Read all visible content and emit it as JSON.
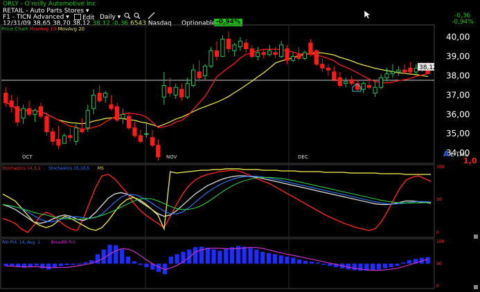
{
  "header": {
    "ticker_line": "ORLY - O'reilly Automotive Inc",
    "sector": "RETAIL - Auto Parts Stores",
    "sector_arrow": "▾",
    "layout": "F1 - TICN Advanced",
    "layout_arrow": "▾",
    "edit": "Edit",
    "period": "Daily",
    "period_arrow": "▾",
    "quote": {
      "date": "12/31/09",
      "open": "38,65",
      "high": "38,70",
      "low": "38,12",
      "close": "38,12",
      "change": "-0,36",
      "volume": "6543",
      "exchange": "Nasdaq",
      "optionable": "Optionable",
      "pct_badge": "-0,94%"
    },
    "change_right": "-0,36",
    "pct_right": "-0,94%",
    "overlay_legend": {
      "price": "Price Chart",
      "ma1": "MovAvg 10",
      "ma2": "MovAvg 20"
    }
  },
  "price_axis": {
    "ticks": [
      "40,00",
      "39,00",
      "38,00",
      "37,00",
      "36,00",
      "35,00",
      "34,00"
    ],
    "last_price": "38,12"
  },
  "x_axis": {
    "labels": [
      "OCT",
      "NOV",
      "DEC"
    ]
  },
  "alert_box": {
    "letter": "A",
    "text": "L TML",
    "value": "1,0"
  },
  "stoch_pane": {
    "legend": [
      "Stochastics 14,3,1",
      "Stochastics 35,10,5",
      "MS"
    ],
    "ticks": [
      "100",
      "50",
      "0"
    ]
  },
  "rsi_pane": {
    "legend": [
      "RSI Pct. 14, Avg. 1",
      "Breadth Pct."
    ],
    "ticks": [
      "100",
      "50",
      "0"
    ]
  },
  "colors": {
    "up": "#22c55e",
    "down": "#ff1a1a",
    "ma_red": "#ff1a1a",
    "ma_yellow": "#e6e34a",
    "badge": "#16c60c"
  },
  "chart_data": [
    {
      "type": "candlestick",
      "title": "ORLY - O'reilly Automotive Inc",
      "y_range": [
        33.5,
        40.6
      ],
      "ylim": [
        33.5,
        40.6
      ],
      "candles": [
        {
          "o": 37.1,
          "h": 37.4,
          "l": 36.4,
          "c": 36.6
        },
        {
          "o": 36.7,
          "h": 37.0,
          "l": 36.1,
          "c": 36.4
        },
        {
          "o": 36.4,
          "h": 36.9,
          "l": 35.4,
          "c": 35.6
        },
        {
          "o": 35.8,
          "h": 36.5,
          "l": 35.5,
          "c": 36.3
        },
        {
          "o": 36.3,
          "h": 36.7,
          "l": 35.9,
          "c": 36.0
        },
        {
          "o": 36.0,
          "h": 36.3,
          "l": 35.6,
          "c": 36.2
        },
        {
          "o": 36.4,
          "h": 36.6,
          "l": 35.8,
          "c": 35.9
        },
        {
          "o": 35.9,
          "h": 36.1,
          "l": 34.9,
          "c": 35.1
        },
        {
          "o": 35.1,
          "h": 35.3,
          "l": 34.4,
          "c": 34.6
        },
        {
          "o": 34.7,
          "h": 35.4,
          "l": 34.2,
          "c": 34.4
        },
        {
          "o": 34.5,
          "h": 35.0,
          "l": 34.5,
          "c": 34.9
        },
        {
          "o": 34.9,
          "h": 35.3,
          "l": 34.6,
          "c": 34.8
        },
        {
          "o": 34.6,
          "h": 35.5,
          "l": 34.4,
          "c": 35.3
        },
        {
          "o": 35.2,
          "h": 35.8,
          "l": 35.0,
          "c": 35.1
        },
        {
          "o": 35.3,
          "h": 36.5,
          "l": 35.1,
          "c": 36.2
        },
        {
          "o": 36.3,
          "h": 37.3,
          "l": 36.0,
          "c": 37.0
        },
        {
          "o": 37.1,
          "h": 37.5,
          "l": 36.6,
          "c": 36.7
        },
        {
          "o": 36.9,
          "h": 37.2,
          "l": 36.6,
          "c": 37.1
        },
        {
          "o": 36.5,
          "h": 37.0,
          "l": 36.2,
          "c": 36.3
        },
        {
          "o": 36.4,
          "h": 36.6,
          "l": 35.6,
          "c": 35.7
        },
        {
          "o": 35.8,
          "h": 36.3,
          "l": 35.5,
          "c": 36.0
        },
        {
          "o": 35.9,
          "h": 36.1,
          "l": 35.2,
          "c": 35.3
        },
        {
          "o": 35.3,
          "h": 35.6,
          "l": 34.8,
          "c": 34.9
        },
        {
          "o": 34.9,
          "h": 35.2,
          "l": 34.5,
          "c": 34.6
        },
        {
          "o": 35.0,
          "h": 35.6,
          "l": 34.8,
          "c": 35.0
        },
        {
          "o": 34.8,
          "h": 35.2,
          "l": 34.3,
          "c": 34.4
        },
        {
          "o": 34.4,
          "h": 34.7,
          "l": 33.6,
          "c": 33.8
        },
        {
          "o": 36.9,
          "h": 38.2,
          "l": 36.5,
          "c": 37.5
        },
        {
          "o": 37.4,
          "h": 37.9,
          "l": 36.9,
          "c": 37.1
        },
        {
          "o": 37.0,
          "h": 37.6,
          "l": 36.8,
          "c": 37.4
        },
        {
          "o": 37.3,
          "h": 37.6,
          "l": 36.7,
          "c": 36.9
        },
        {
          "o": 36.9,
          "h": 37.9,
          "l": 36.8,
          "c": 37.6
        },
        {
          "o": 37.5,
          "h": 38.6,
          "l": 37.4,
          "c": 38.3
        },
        {
          "o": 38.2,
          "h": 38.8,
          "l": 37.7,
          "c": 37.9
        },
        {
          "o": 38.0,
          "h": 38.6,
          "l": 37.8,
          "c": 38.5
        },
        {
          "o": 38.5,
          "h": 39.5,
          "l": 38.4,
          "c": 39.3
        },
        {
          "o": 39.3,
          "h": 39.8,
          "l": 38.8,
          "c": 39.0
        },
        {
          "o": 39.0,
          "h": 40.1,
          "l": 39.0,
          "c": 39.9
        },
        {
          "o": 39.9,
          "h": 40.3,
          "l": 39.2,
          "c": 39.4
        },
        {
          "o": 39.3,
          "h": 39.7,
          "l": 39.0,
          "c": 39.6
        },
        {
          "o": 39.5,
          "h": 40.0,
          "l": 39.3,
          "c": 39.8
        },
        {
          "o": 39.7,
          "h": 39.9,
          "l": 39.2,
          "c": 39.4
        },
        {
          "o": 39.4,
          "h": 39.6,
          "l": 38.9,
          "c": 39.0
        },
        {
          "o": 39.0,
          "h": 39.5,
          "l": 38.8,
          "c": 39.2
        },
        {
          "o": 39.2,
          "h": 39.4,
          "l": 38.9,
          "c": 39.1
        },
        {
          "o": 39.1,
          "h": 39.6,
          "l": 39.0,
          "c": 39.3
        },
        {
          "o": 39.2,
          "h": 39.5,
          "l": 38.9,
          "c": 39.1
        },
        {
          "o": 39.0,
          "h": 39.8,
          "l": 38.9,
          "c": 39.6
        },
        {
          "o": 39.4,
          "h": 39.6,
          "l": 38.6,
          "c": 38.8
        },
        {
          "o": 38.8,
          "h": 39.2,
          "l": 38.7,
          "c": 39.0
        },
        {
          "o": 39.1,
          "h": 39.5,
          "l": 38.8,
          "c": 38.9
        },
        {
          "o": 38.9,
          "h": 39.3,
          "l": 38.8,
          "c": 39.2
        },
        {
          "o": 39.7,
          "h": 39.9,
          "l": 39.0,
          "c": 39.1
        },
        {
          "o": 39.3,
          "h": 39.4,
          "l": 38.5,
          "c": 38.6
        },
        {
          "o": 38.6,
          "h": 38.9,
          "l": 38.2,
          "c": 38.4
        },
        {
          "o": 38.4,
          "h": 38.6,
          "l": 38.0,
          "c": 38.3
        },
        {
          "o": 38.2,
          "h": 38.5,
          "l": 37.7,
          "c": 37.8
        },
        {
          "o": 37.9,
          "h": 38.2,
          "l": 37.4,
          "c": 37.5
        },
        {
          "o": 37.6,
          "h": 37.9,
          "l": 37.4,
          "c": 37.7
        },
        {
          "o": 37.8,
          "h": 38.0,
          "l": 37.5,
          "c": 37.6
        },
        {
          "o": 37.6,
          "h": 37.8,
          "l": 37.2,
          "c": 37.3
        },
        {
          "o": 37.3,
          "h": 37.7,
          "l": 37.1,
          "c": 37.6
        },
        {
          "o": 37.5,
          "h": 37.8,
          "l": 37.3,
          "c": 37.4
        },
        {
          "o": 37.1,
          "h": 37.7,
          "l": 36.9,
          "c": 37.4
        },
        {
          "o": 37.4,
          "h": 38.1,
          "l": 37.3,
          "c": 37.9
        },
        {
          "o": 37.9,
          "h": 38.4,
          "l": 37.7,
          "c": 38.1
        },
        {
          "o": 38.1,
          "h": 38.6,
          "l": 37.9,
          "c": 38.2
        },
        {
          "o": 38.2,
          "h": 38.5,
          "l": 38.0,
          "c": 38.3
        },
        {
          "o": 38.3,
          "h": 38.6,
          "l": 38.1,
          "c": 38.2
        },
        {
          "o": 38.4,
          "h": 38.7,
          "l": 38.1,
          "c": 38.2
        },
        {
          "o": 38.2,
          "h": 38.6,
          "l": 38.0,
          "c": 38.4
        },
        {
          "o": 38.4,
          "h": 38.7,
          "l": 38.2,
          "c": 38.3
        },
        {
          "o": 38.65,
          "h": 38.7,
          "l": 38.12,
          "c": 38.12
        }
      ]
    },
    {
      "type": "line",
      "series": [
        {
          "name": "Stochastics 14,3,1",
          "values": [
            25,
            22,
            18,
            10,
            5,
            15,
            28,
            34,
            30,
            22,
            15,
            10,
            8,
            25,
            48,
            70,
            86,
            88,
            82,
            72,
            62,
            48,
            38,
            30,
            24,
            18,
            12,
            28,
            45,
            60,
            72,
            80,
            85,
            88,
            90,
            92,
            93,
            94,
            93,
            90,
            86,
            82,
            78,
            75,
            70,
            65,
            60,
            55,
            50,
            45,
            40,
            35,
            30,
            26,
            22,
            18,
            15,
            12,
            10,
            8,
            10,
            20,
            35,
            52,
            68,
            80,
            84,
            86,
            82,
            78
          ]
        },
        {
          "name": "Stochastics 35,10,5",
          "values": [
            45,
            42,
            38,
            32,
            26,
            20,
            18,
            20,
            24,
            28,
            30,
            28,
            24,
            22,
            26,
            34,
            44,
            54,
            60,
            62,
            60,
            56,
            50,
            44,
            38,
            32,
            28,
            30,
            36,
            44,
            52,
            60,
            66,
            72,
            76,
            80,
            83,
            85,
            86,
            86,
            85,
            84,
            82,
            80,
            78,
            76,
            74,
            72,
            70,
            68,
            66,
            64,
            62,
            60,
            58,
            56,
            54,
            52,
            50,
            48,
            46,
            45,
            45,
            46,
            48,
            50,
            50,
            49,
            48,
            47
          ]
        },
        {
          "name": "MS",
          "values": [
            60,
            55,
            50,
            40,
            30,
            20,
            15,
            12,
            15,
            22,
            28,
            25,
            20,
            15,
            10,
            8,
            12,
            22,
            34,
            45,
            52,
            55,
            52,
            46,
            38,
            30,
            10,
            92,
            90,
            91,
            92,
            93,
            94,
            94,
            95,
            95,
            96,
            96,
            96,
            95,
            95,
            95,
            94,
            94,
            94,
            93,
            93,
            93,
            92,
            92,
            92,
            92,
            91,
            91,
            91,
            91,
            90,
            90,
            90,
            90,
            90,
            89,
            89,
            89,
            89,
            88,
            88,
            88,
            88,
            88
          ]
        }
      ]
    },
    {
      "type": "bar",
      "series": [
        {
          "name": "RSI Pct. 14, Avg. 1",
          "values": [
            -10,
            -12,
            -15,
            -18,
            -12,
            -8,
            -20,
            -25,
            -18,
            -10,
            -6,
            -5,
            -4,
            6,
            15,
            40,
            60,
            80,
            78,
            60,
            30,
            10,
            -5,
            -15,
            -25,
            -35,
            -45,
            30,
            40,
            50,
            60,
            70,
            72,
            68,
            60,
            55,
            62,
            70,
            75,
            72,
            66,
            60,
            50,
            45,
            40,
            35,
            30,
            25,
            18,
            12,
            8,
            5,
            -5,
            -10,
            -15,
            -20,
            -25,
            -28,
            -30,
            -30,
            -28,
            -25,
            -20,
            -15,
            -10,
            5,
            15,
            20,
            25,
            28
          ]
        }
      ]
    }
  ]
}
